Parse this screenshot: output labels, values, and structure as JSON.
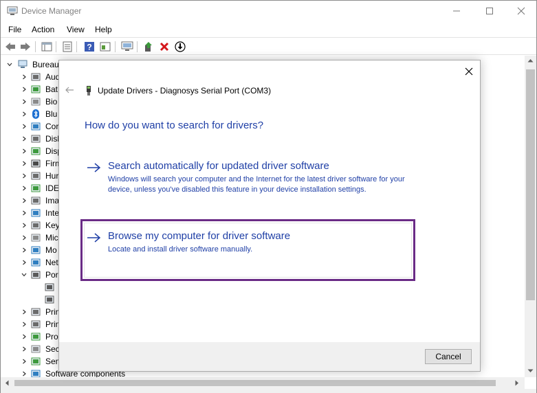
{
  "window": {
    "title": "Device Manager"
  },
  "menu": {
    "file": "File",
    "action": "Action",
    "view": "View",
    "help": "Help"
  },
  "tree": {
    "root_label": "Bureau",
    "items": [
      {
        "label": "Aud",
        "icon": "audio-icon"
      },
      {
        "label": "Bat",
        "icon": "battery-icon"
      },
      {
        "label": "Bio",
        "icon": "biometric-icon"
      },
      {
        "label": "Blu",
        "icon": "bluetooth-icon"
      },
      {
        "label": "Cor",
        "icon": "computer-icon"
      },
      {
        "label": "Disl",
        "icon": "disk-drive-icon"
      },
      {
        "label": "Disp",
        "icon": "display-adapter-icon"
      },
      {
        "label": "Firm",
        "icon": "firmware-icon"
      },
      {
        "label": "Hur",
        "icon": "hid-icon"
      },
      {
        "label": "IDE",
        "icon": "ide-icon"
      },
      {
        "label": "Ima",
        "icon": "imaging-icon"
      },
      {
        "label": "Inte",
        "icon": "intel-icon"
      },
      {
        "label": "Key",
        "icon": "keyboard-icon"
      },
      {
        "label": "Mic",
        "icon": "mouse-icon"
      },
      {
        "label": "Mo",
        "icon": "monitor-icon"
      },
      {
        "label": "Net",
        "icon": "network-icon"
      },
      {
        "label": "Por",
        "icon": "port-icon"
      },
      {
        "label": "",
        "icon": "port-device-icon"
      },
      {
        "label": "",
        "icon": "port-device-icon"
      },
      {
        "label": "Prin",
        "icon": "print-queue-icon"
      },
      {
        "label": "Prin",
        "icon": "printer-icon"
      },
      {
        "label": "Pro",
        "icon": "processor-icon"
      },
      {
        "label": "Sec",
        "icon": "security-icon"
      },
      {
        "label": "Sen",
        "icon": "sensor-icon"
      },
      {
        "label": "Software components",
        "icon": "software-icon"
      }
    ]
  },
  "dialog": {
    "title": "Update Drivers - Diagnosys Serial Port (COM3)",
    "heading": "How do you want to search for drivers?",
    "option_auto": {
      "title": "Search automatically for updated driver software",
      "desc": "Windows will search your computer and the Internet for the latest driver software for your device, unless you've disabled this feature in your device installation settings."
    },
    "option_browse": {
      "title": "Browse my computer for driver software",
      "desc": "Locate and install driver software manually."
    },
    "cancel_label": "Cancel"
  },
  "colors": {
    "link_blue": "#1f3fa6",
    "highlight_purple": "#6a2b86"
  }
}
